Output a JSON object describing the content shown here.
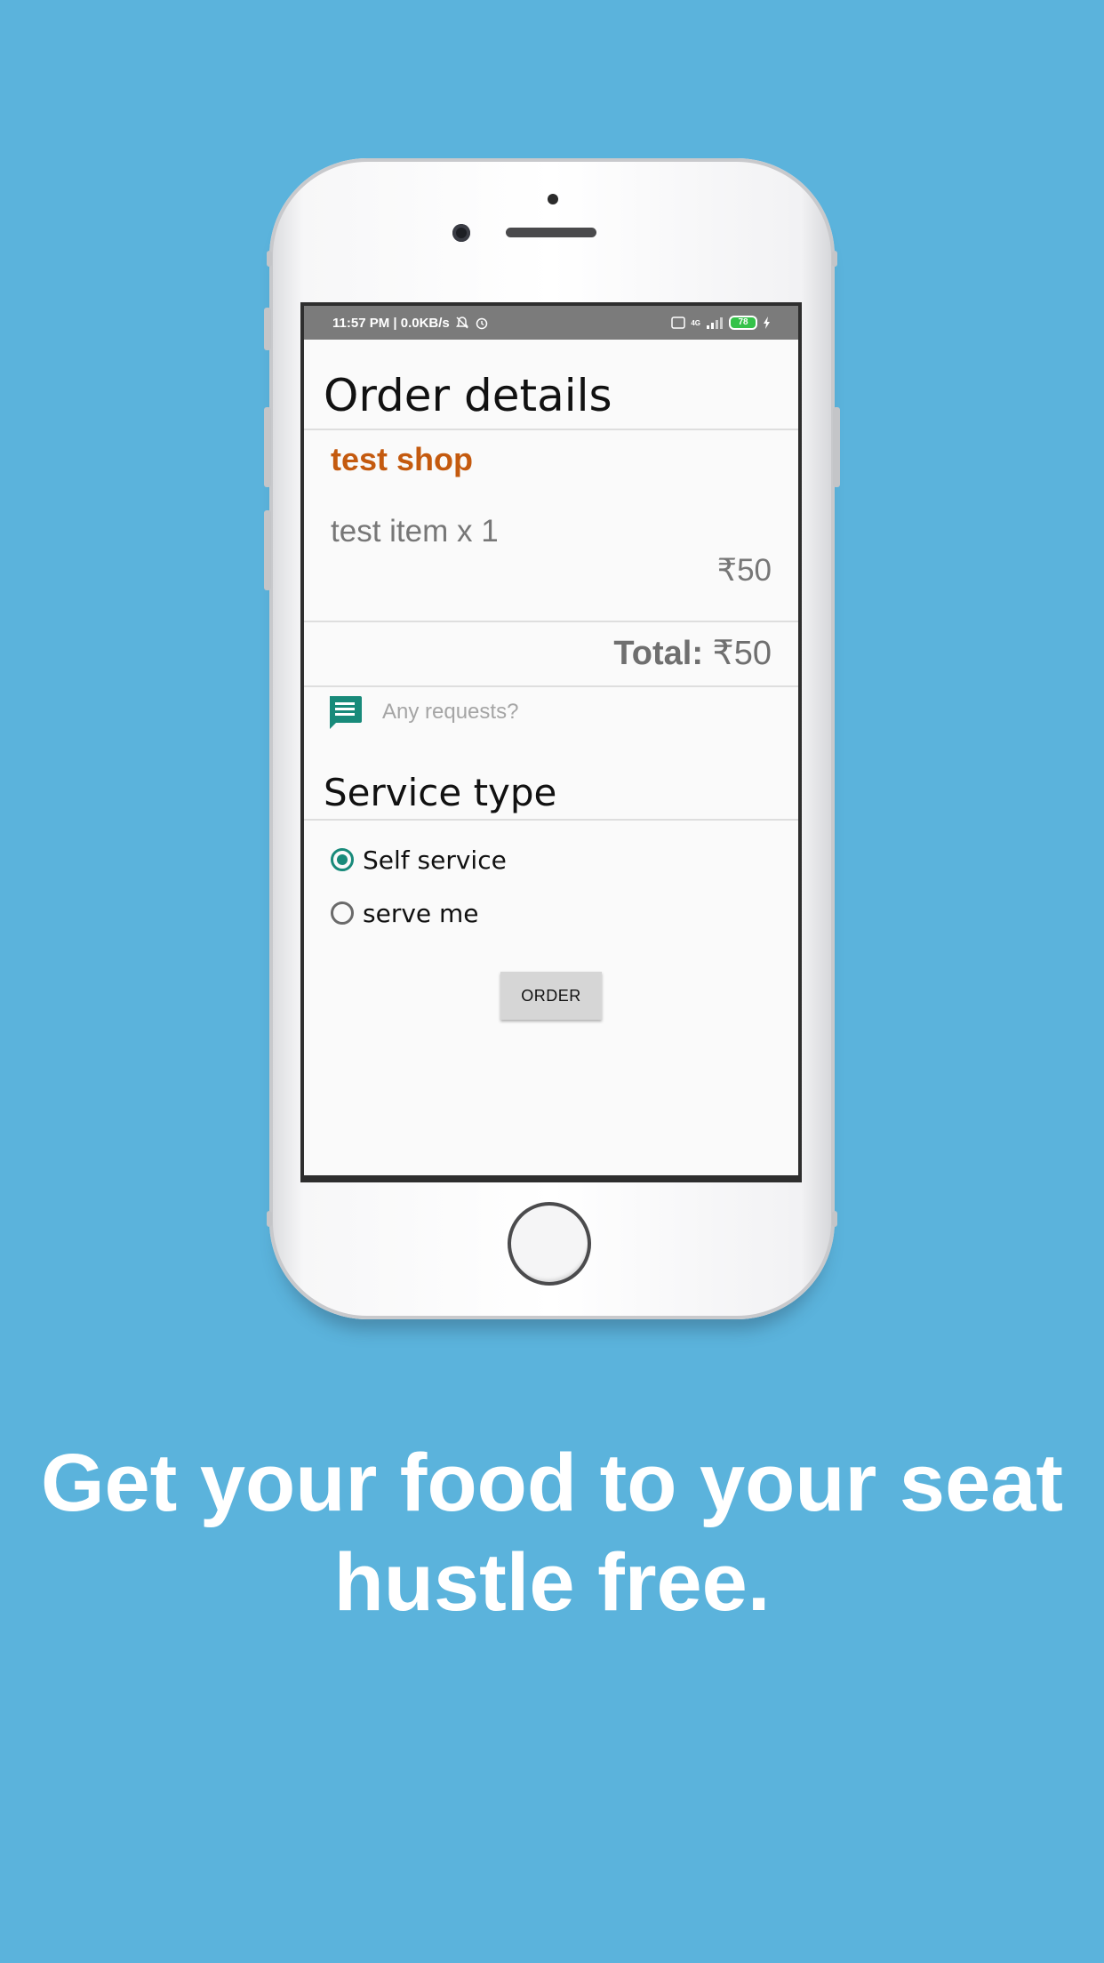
{
  "status_bar": {
    "left_text": "11:57 PM | 0.0KB/s",
    "network": "4G",
    "battery": "78"
  },
  "screen": {
    "title": "Order details",
    "shop_name": "test shop",
    "item_line": "test item x 1",
    "item_price": "₹50",
    "total_label": "Total:",
    "total_value": "₹50",
    "requests_placeholder": "Any requests?",
    "service_heading": "Service type",
    "service_options": [
      {
        "label": "Self service",
        "selected": true
      },
      {
        "label": "serve me",
        "selected": false
      }
    ],
    "order_button": "ORDER"
  },
  "tagline": {
    "line1": "Get your food to your seat",
    "line2": "hustle free."
  },
  "colors": {
    "background": "#5bb3dc",
    "shop_accent": "#c45a0f",
    "radio_accent": "#188a7a"
  }
}
